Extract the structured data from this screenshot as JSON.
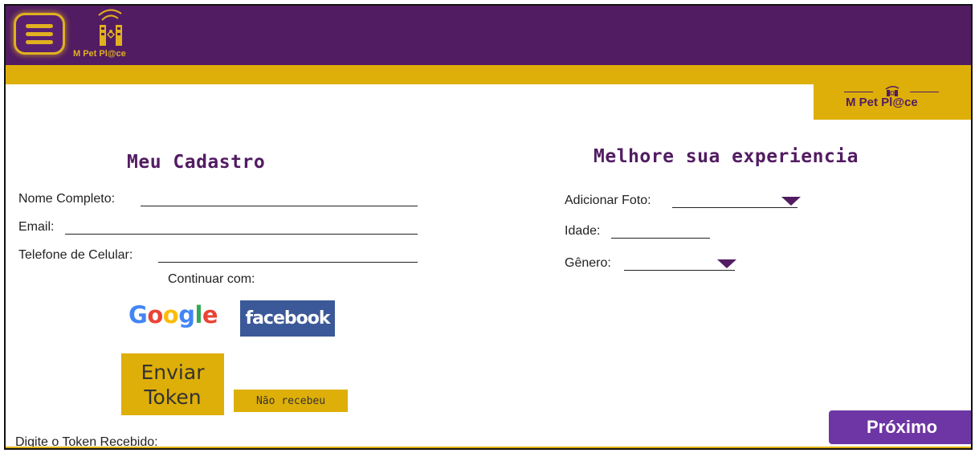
{
  "header": {
    "brand": "M Pet Pl@ce",
    "colors": {
      "purple": "#521c62",
      "gold": "#deaf08",
      "button_purple": "#6e36a4"
    }
  },
  "cadastro": {
    "title": "Meu Cadastro",
    "fields": {
      "nome": "Nome Completo:",
      "email": "Email:",
      "telefone": "Telefone de Celular:"
    },
    "continue_label": "Continuar com:",
    "google": [
      "G",
      "o",
      "o",
      "g",
      "l",
      "e"
    ],
    "facebook": "facebook",
    "send_token": "Enviar Token",
    "resend": "Não recebeu",
    "token_label": "Digite o Token Recebido:"
  },
  "experiencia": {
    "title": "Melhore sua experiencia",
    "fields": {
      "foto": "Adicionar Foto:",
      "idade": "Idade:",
      "genero": "Gênero:"
    }
  },
  "next_button": "Próximo",
  "icons": [
    "menu-icon",
    "brand-logo-icon",
    "chevron-down-icon"
  ]
}
